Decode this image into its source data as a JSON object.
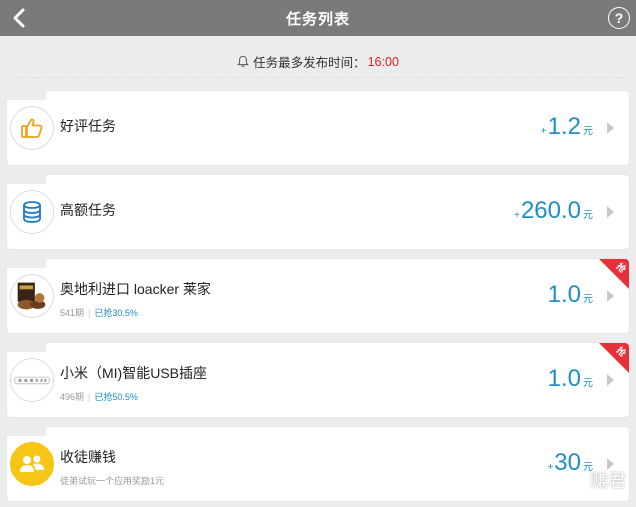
{
  "header": {
    "title": "任务列表",
    "help_label": "?"
  },
  "notice": {
    "label": "任务最多发布时间：",
    "time": "16:00"
  },
  "tasks": [
    {
      "title": "好评任务",
      "amount_prefix": "+",
      "amount": "1.2",
      "unit": "元",
      "icon": "thumbs-up-icon"
    },
    {
      "title": "高额任务",
      "amount_prefix": "+",
      "amount": "260.0",
      "unit": "元",
      "icon": "coin-stack-icon"
    },
    {
      "title": "奥地利进口 loacker 莱家",
      "sales": "541期",
      "grabbed": "已抢30.5%",
      "amount": "1.0",
      "unit": "元",
      "badge": "抢",
      "icon": "product-thumbnail"
    },
    {
      "title": "小米（MI)智能USB插座",
      "sales": "496期",
      "grabbed": "已抢50.5%",
      "amount": "1.0",
      "unit": "元",
      "badge": "抢",
      "icon": "product-thumbnail"
    },
    {
      "title": "收徒赚钱",
      "subtitle": "徒弟试玩一个应用奖励1元",
      "amount_prefix": "+",
      "amount": "30",
      "unit": "元",
      "icon": "people-icon"
    }
  ],
  "watermark": {
    "text": "赚君"
  },
  "colors": {
    "navbar": "#7a7a7a",
    "accent_blue": "#1e8fc6",
    "highlight_red": "#e02020",
    "ribbon_red": "#e8303a",
    "icon_yellow": "#f7c614",
    "icon_blue": "#1f7bc1"
  }
}
